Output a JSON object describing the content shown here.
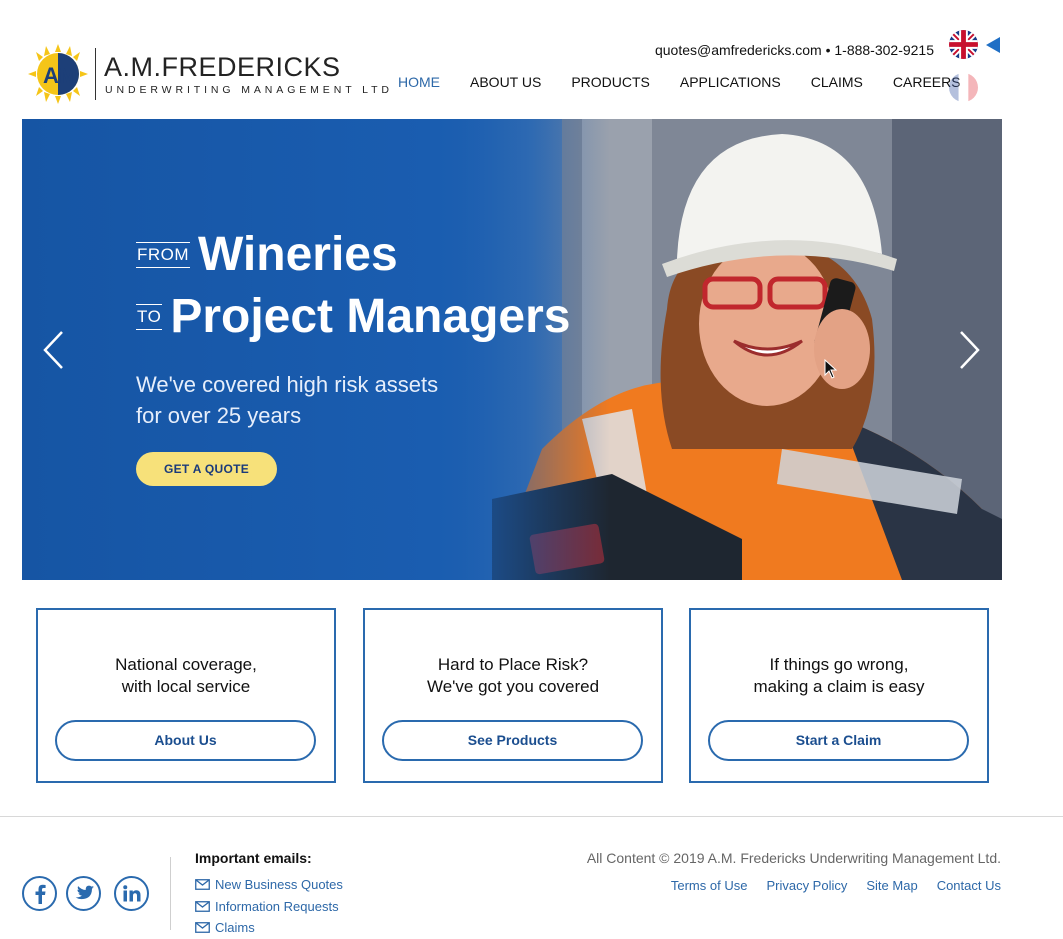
{
  "brand": {
    "monogram": "AM",
    "name": "A.M.FREDERICKS",
    "subtitle": "UNDERWRITING MANAGEMENT LTD"
  },
  "header": {
    "contact": "quotes@amfredericks.com • 1-888-302-9215",
    "nav": [
      "HOME",
      "ABOUT US",
      "PRODUCTS",
      "APPLICATIONS",
      "CLAIMS",
      "CAREERS"
    ],
    "active_nav": "HOME",
    "languages": [
      "uk-flag-icon",
      "france-flag-icon"
    ]
  },
  "hero": {
    "prefix1": "FROM",
    "headline1": "Wineries",
    "prefix2": "TO",
    "headline2": "Project Managers",
    "tagline_line1": "We've covered high risk assets",
    "tagline_line2": "for over 25 years",
    "cta": "GET A QUOTE"
  },
  "cards": [
    {
      "text": "National coverage,\nwith local service",
      "button": "About Us"
    },
    {
      "text": "Hard to Place Risk?\nWe've got you covered",
      "button": "See Products"
    },
    {
      "text": "If things go wrong,\nmaking a claim is easy",
      "button": "Start a Claim"
    }
  ],
  "footer": {
    "social": [
      "facebook-icon",
      "twitter-icon",
      "linkedin-icon"
    ],
    "emails_title": "Important emails:",
    "emails": [
      "New Business Quotes",
      "Information Requests",
      "Claims"
    ],
    "copyright": "All Content © 2019 A.M. Fredericks Underwriting Management Ltd.",
    "links": [
      "Terms of Use",
      "Privacy Policy",
      "Site Map",
      "Contact Us"
    ]
  },
  "colors": {
    "brand_blue": "#2a6aae",
    "hero_blue": "#1655a4",
    "cta_yellow": "#f7e17a",
    "logo_yellow": "#f5c518"
  }
}
